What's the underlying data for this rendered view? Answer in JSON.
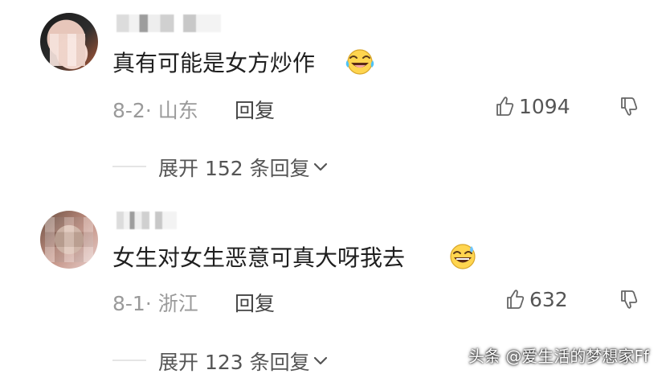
{
  "comments": [
    {
      "text": "真有可能是女方炒作",
      "meta": "8-2· 山东",
      "reply_label": "回复",
      "likes": "1094",
      "expand_label": "展开 152 条回复"
    },
    {
      "text": "女生对女生恶意可真大呀我去",
      "meta": "8-1· 浙江",
      "reply_label": "回复",
      "likes": "632",
      "expand_label": "展开 123 条回复"
    }
  ],
  "watermark": "头条 @爱生活的梦想家Ff",
  "icons": {
    "like": "thumb-up-icon",
    "dislike": "thumb-down-icon",
    "expand": "chevron-down-icon",
    "emoji_1": "laughing-tears-icon",
    "emoji_2": "sweat-smile-icon"
  },
  "colors": {
    "text": "#1f1f1f",
    "muted": "#9a9a9a",
    "secondary": "#555555",
    "divider": "#e5e5e5",
    "watermark": "#ffffff"
  }
}
